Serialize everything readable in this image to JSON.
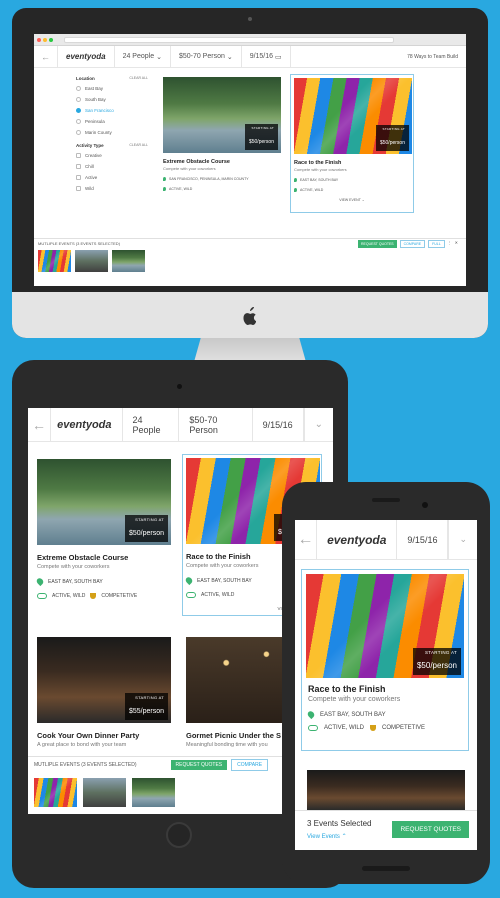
{
  "brand": {
    "logo": "eventyoda"
  },
  "nav": {
    "people": "24 People",
    "price": "$50-70 Person",
    "date": "9/15/16",
    "ways": "78 Ways to Team Build"
  },
  "filters": {
    "location": {
      "title": "Location",
      "clear": "CLEAR ALL",
      "options": [
        "East Bay",
        "South Bay",
        "San Francisco",
        "Peninsula",
        "Marin County"
      ]
    },
    "activity": {
      "title": "Activity Type",
      "clear": "CLEAR ALL",
      "options": [
        "Creative",
        "Chill",
        "Active",
        "Wild"
      ]
    }
  },
  "cards": [
    {
      "title": "Extreme Obstacle Course",
      "subtitle": "Compete with your coworkers",
      "location": "EAST BAY, SOUTH BAY",
      "location_desktop": "SAN FRANCISCO, PENINSULA, MARIN COUNTY",
      "tags": "ACTIVE, WILD",
      "price_label": "STARTING AT",
      "price": "$50/person"
    },
    {
      "title": "Race to the Finish",
      "subtitle": "Compete with your coworkers",
      "location": "EAST BAY, SOUTH BAY",
      "tags": "ACTIVE, WILD",
      "extra_tag": "COMPETETIVE",
      "price_label": "STARTING AT",
      "price": "$50/person",
      "view": "VIEW EVENT"
    },
    {
      "title": "Cook Your Own Dinner Party",
      "subtitle": "A great place to bond with your team",
      "price": "$55/person"
    },
    {
      "title": "Gormet Picnic Under the S",
      "subtitle": "Meaningful bonding time with you"
    }
  ],
  "bar": {
    "multi_desktop": "MUTLIPLE EVENTS (3 EVENTS SELECTED)",
    "multi_tablet": "MUTLIPLE EVENTS (3 EVENTS SELECTED)",
    "request": "REQUEST QUOTES",
    "compare": "COMPARE",
    "full": "FULL"
  },
  "phone": {
    "count": "3 Events Selected",
    "view_events": "View Events",
    "request": "REQUEST QUOTES"
  }
}
